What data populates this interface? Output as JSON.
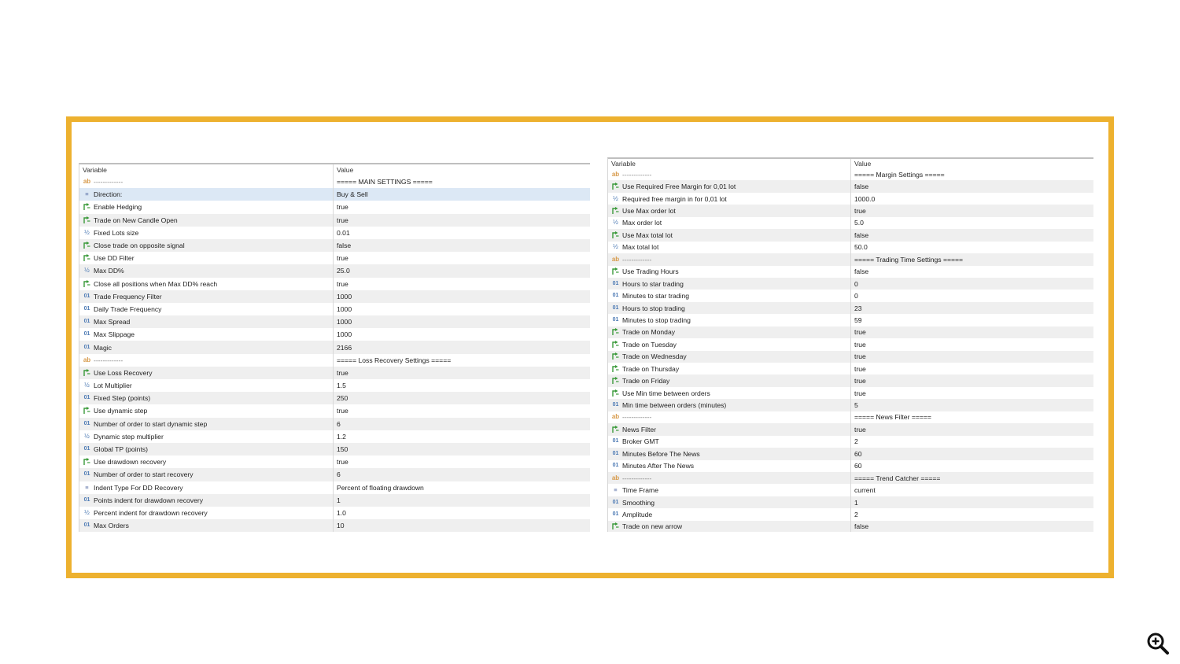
{
  "left_table": {
    "headers": {
      "variable": "Variable",
      "value": "Value"
    },
    "rows": [
      {
        "icon": "ab",
        "variable": "-------------",
        "value": "===== MAIN SETTINGS ====="
      },
      {
        "icon": "enum",
        "variable": "Direction:",
        "value": "Buy & Sell"
      },
      {
        "icon": "bool",
        "variable": "Enable Hedging",
        "value": "true"
      },
      {
        "icon": "bool",
        "variable": "Trade on New Candle Open",
        "value": "true"
      },
      {
        "icon": "frac",
        "variable": "Fixed Lots size",
        "value": "0.01"
      },
      {
        "icon": "bool",
        "variable": "Close trade on opposite signal",
        "value": "false"
      },
      {
        "icon": "bool",
        "variable": "Use DD Filter",
        "value": "true"
      },
      {
        "icon": "frac",
        "variable": "Max DD%",
        "value": "25.0"
      },
      {
        "icon": "bool",
        "variable": "Close all positions when Max DD% reach",
        "value": "true"
      },
      {
        "icon": "num",
        "variable": "Trade Frequency Filter",
        "value": "1000"
      },
      {
        "icon": "num",
        "variable": "Daily Trade Frequency",
        "value": "1000"
      },
      {
        "icon": "num",
        "variable": "Max Spread",
        "value": "1000"
      },
      {
        "icon": "num",
        "variable": "Max Slippage",
        "value": "1000"
      },
      {
        "icon": "num",
        "variable": "Magic",
        "value": "2166"
      },
      {
        "icon": "ab",
        "variable": "-------------",
        "value": "===== Loss Recovery Settings ====="
      },
      {
        "icon": "bool",
        "variable": "Use Loss Recovery",
        "value": "true"
      },
      {
        "icon": "frac",
        "variable": "Lot Multiplier",
        "value": "1.5"
      },
      {
        "icon": "num",
        "variable": "Fixed Step (points)",
        "value": "250"
      },
      {
        "icon": "bool",
        "variable": "Use dynamic step",
        "value": "true"
      },
      {
        "icon": "num",
        "variable": "Number of order to start dynamic step",
        "value": "6"
      },
      {
        "icon": "frac",
        "variable": "Dynamic step multiplier",
        "value": "1.2"
      },
      {
        "icon": "num",
        "variable": "Global TP (points)",
        "value": "150"
      },
      {
        "icon": "bool",
        "variable": "Use drawdown recovery",
        "value": "true"
      },
      {
        "icon": "num",
        "variable": "Number of order to start recovery",
        "value": "6"
      },
      {
        "icon": "enum",
        "variable": "Indent Type For DD Recovery",
        "value": "Percent of floating drawdown"
      },
      {
        "icon": "num",
        "variable": "Points indent for drawdown recovery",
        "value": "1"
      },
      {
        "icon": "frac",
        "variable": "Percent indent for drawdown recovery",
        "value": "1.0"
      },
      {
        "icon": "num",
        "variable": "Max Orders",
        "value": "10"
      }
    ]
  },
  "right_table": {
    "headers": {
      "variable": "Variable",
      "value": "Value"
    },
    "rows": [
      {
        "icon": "ab",
        "variable": "-------------",
        "value": "===== Margin Settings ====="
      },
      {
        "icon": "bool",
        "variable": "Use Required Free Margin for 0,01 lot",
        "value": "false"
      },
      {
        "icon": "frac",
        "variable": "Required free margin in for 0,01 lot",
        "value": "1000.0"
      },
      {
        "icon": "bool",
        "variable": "Use Max order lot",
        "value": "true"
      },
      {
        "icon": "frac",
        "variable": "Max order lot",
        "value": "5.0"
      },
      {
        "icon": "bool",
        "variable": "Use Max total lot",
        "value": "false"
      },
      {
        "icon": "frac",
        "variable": "Max total lot",
        "value": "50.0"
      },
      {
        "icon": "ab",
        "variable": "-------------",
        "value": "===== Trading Time Settings ====="
      },
      {
        "icon": "bool",
        "variable": "Use Trading Hours",
        "value": "false"
      },
      {
        "icon": "num",
        "variable": "Hours to star trading",
        "value": "0"
      },
      {
        "icon": "num",
        "variable": "Minutes to star trading",
        "value": "0"
      },
      {
        "icon": "num",
        "variable": "Hours to stop trading",
        "value": "23"
      },
      {
        "icon": "num",
        "variable": "Minutes to stop trading",
        "value": "59"
      },
      {
        "icon": "bool",
        "variable": "Trade on Monday",
        "value": "true"
      },
      {
        "icon": "bool",
        "variable": "Trade on Tuesday",
        "value": "true"
      },
      {
        "icon": "bool",
        "variable": "Trade on Wednesday",
        "value": "true"
      },
      {
        "icon": "bool",
        "variable": "Trade on Thursday",
        "value": "true"
      },
      {
        "icon": "bool",
        "variable": "Trade on Friday",
        "value": "true"
      },
      {
        "icon": "bool",
        "variable": "Use Min time between orders",
        "value": "true"
      },
      {
        "icon": "num",
        "variable": "Min time between orders (minutes)",
        "value": "5"
      },
      {
        "icon": "ab",
        "variable": "-------------",
        "value": "===== News Filter ====="
      },
      {
        "icon": "bool",
        "variable": "News Filter",
        "value": "true"
      },
      {
        "icon": "num",
        "variable": "Broker GMT",
        "value": "2"
      },
      {
        "icon": "num",
        "variable": "Minutes Before The News",
        "value": "60"
      },
      {
        "icon": "num",
        "variable": "Minutes After The News",
        "value": "60"
      },
      {
        "icon": "ab",
        "variable": "-------------",
        "value": "===== Trend Catcher ====="
      },
      {
        "icon": "enum",
        "variable": "Time Frame",
        "value": "current"
      },
      {
        "icon": "num",
        "variable": "Smoothing",
        "value": "1"
      },
      {
        "icon": "num",
        "variable": "Amplitude",
        "value": "2"
      },
      {
        "icon": "bool",
        "variable": "Trade on new arrow",
        "value": "false"
      }
    ]
  },
  "icon_glyphs": {
    "ab": "ab",
    "num": "01",
    "frac": "½",
    "enum": "≡",
    "bool": ""
  },
  "colors": {
    "frame_border": "#edb12f",
    "alt_row": "#efefef",
    "selected_row": "#dce8f5",
    "bool_icon": "#3a9a3a"
  },
  "zoom_icon": "zoom-in-icon"
}
